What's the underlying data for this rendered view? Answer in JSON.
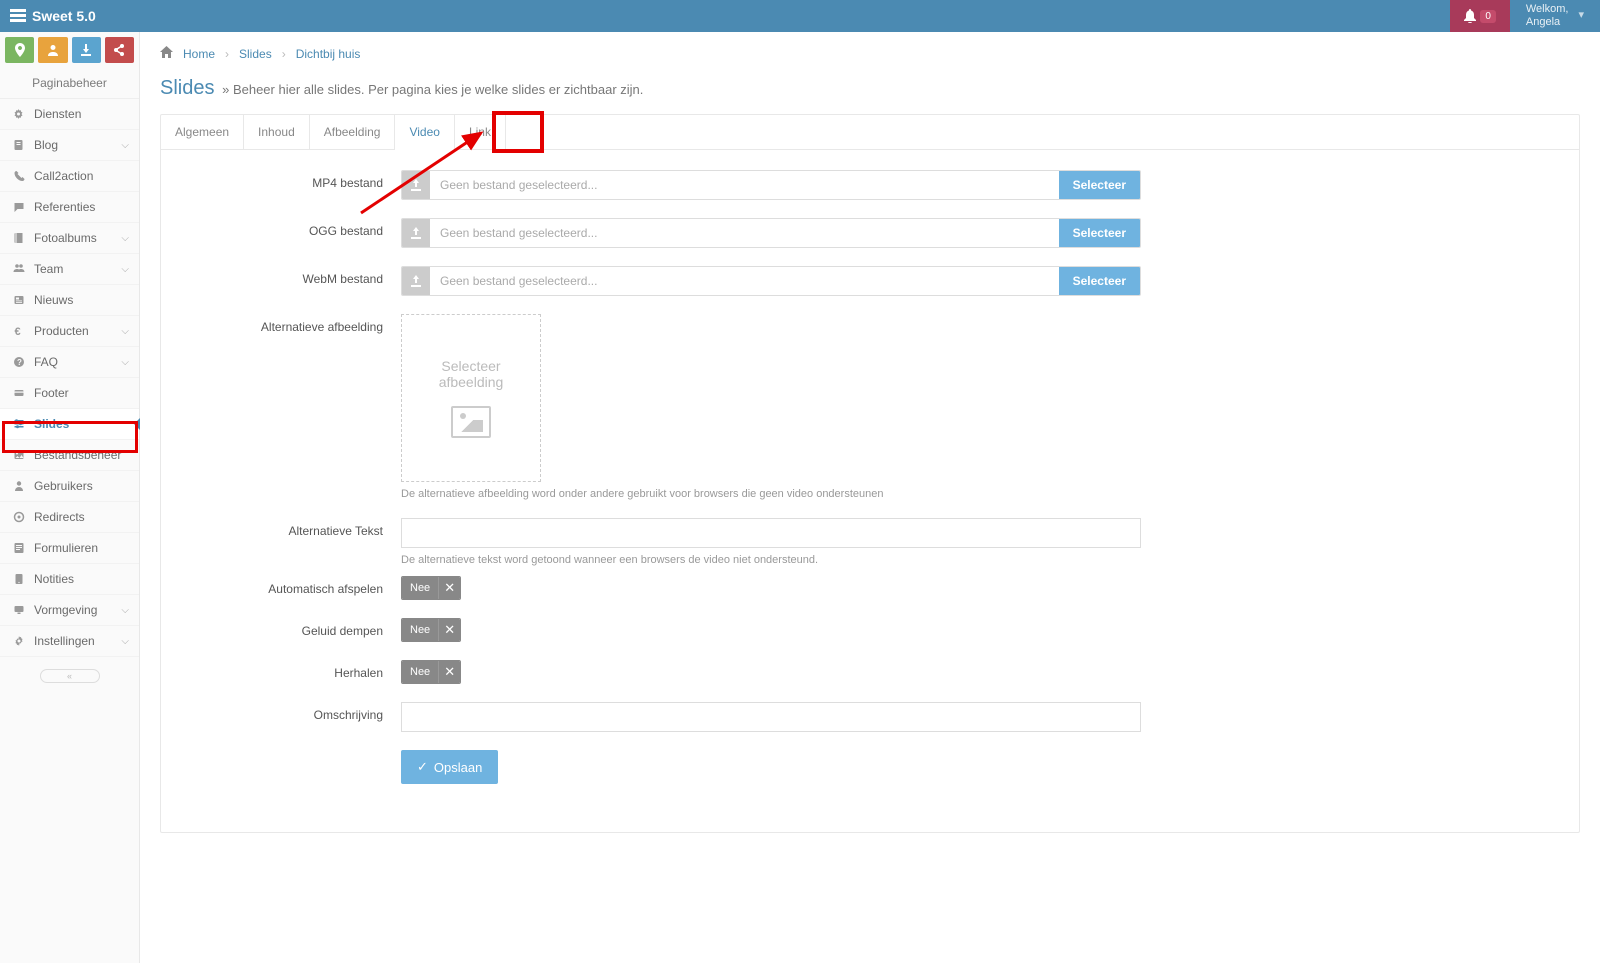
{
  "brand": "Sweet 5.0",
  "notif_count": "0",
  "welcome_prefix": "Welkom,",
  "welcome_name": "Angela",
  "breadcrumb": {
    "home": "Home",
    "slides": "Slides",
    "current": "Dichtbij huis"
  },
  "page_title": "Slides",
  "page_sub": "» Beheer hier alle slides. Per pagina kies je welke slides er zichtbaar zijn.",
  "sidebar_header": "Paginabeheer",
  "sidebar": [
    {
      "label": "Diensten",
      "icon": "gears",
      "expand": false
    },
    {
      "label": "Blog",
      "icon": "note",
      "expand": true
    },
    {
      "label": "Call2action",
      "icon": "phone",
      "expand": false
    },
    {
      "label": "Referenties",
      "icon": "comment",
      "expand": false
    },
    {
      "label": "Fotoalbums",
      "icon": "book",
      "expand": true
    },
    {
      "label": "Team",
      "icon": "users",
      "expand": true
    },
    {
      "label": "Nieuws",
      "icon": "news",
      "expand": false
    },
    {
      "label": "Producten",
      "icon": "euro",
      "expand": true
    },
    {
      "label": "FAQ",
      "icon": "help",
      "expand": true
    },
    {
      "label": "Footer",
      "icon": "card",
      "expand": false
    },
    {
      "label": "Slides",
      "icon": "sliders",
      "expand": false,
      "active": true
    },
    {
      "label": "Bestandsbeheer",
      "icon": "image",
      "expand": false
    },
    {
      "label": "Gebruikers",
      "icon": "user",
      "expand": false
    },
    {
      "label": "Redirects",
      "icon": "target",
      "expand": false
    },
    {
      "label": "Formulieren",
      "icon": "form",
      "expand": false
    },
    {
      "label": "Notities",
      "icon": "tablet",
      "expand": false
    },
    {
      "label": "Vormgeving",
      "icon": "screen",
      "expand": true
    },
    {
      "label": "Instellingen",
      "icon": "gear",
      "expand": true
    }
  ],
  "tabs": [
    "Algemeen",
    "Inhoud",
    "Afbeelding",
    "Video",
    "Link"
  ],
  "active_tab": "Video",
  "form": {
    "mp4_label": "MP4 bestand",
    "ogg_label": "OGG bestand",
    "webm_label": "WebM bestand",
    "file_placeholder": "Geen bestand geselecteerd...",
    "select_btn": "Selecteer",
    "alt_img_label": "Alternatieve afbeelding",
    "alt_img_picker_l1": "Selecteer",
    "alt_img_picker_l2": "afbeelding",
    "alt_img_help": "De alternatieve afbeelding word onder andere gebruikt voor browsers die geen video ondersteunen",
    "alt_text_label": "Alternatieve Tekst",
    "alt_text_help": "De alternatieve tekst word getoond wanneer een browsers de video niet ondersteund.",
    "autoplay_label": "Automatisch afspelen",
    "mute_label": "Geluid dempen",
    "repeat_label": "Herhalen",
    "toggle_off": "Nee",
    "desc_label": "Omschrijving",
    "save_btn": "Opslaan"
  }
}
